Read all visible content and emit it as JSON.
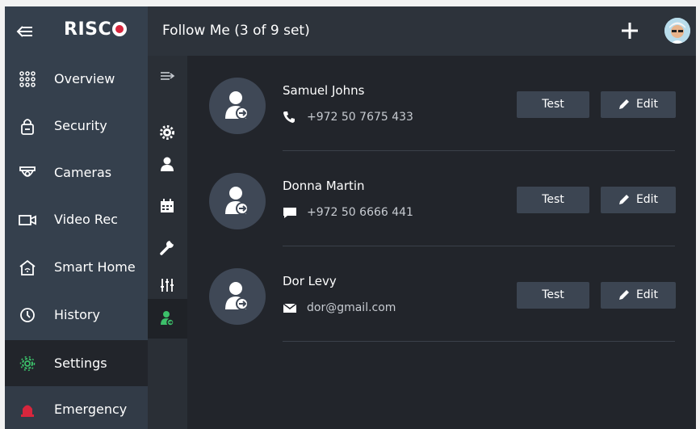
{
  "topbar": {
    "title": "Follow Me (3 of 9 set)"
  },
  "sidebar": {
    "logo": "RISC",
    "items": [
      {
        "label": "Overview",
        "icon": "grid-icon"
      },
      {
        "label": "Security",
        "icon": "lock-icon"
      },
      {
        "label": "Cameras",
        "icon": "camera-icon"
      },
      {
        "label": "Video Rec",
        "icon": "video-icon"
      },
      {
        "label": "Smart Home",
        "icon": "home-icon"
      },
      {
        "label": "History",
        "icon": "history-icon"
      },
      {
        "label": "Settings",
        "icon": "gear-icon",
        "active": true
      },
      {
        "label": "Emergency",
        "icon": "siren-icon"
      }
    ]
  },
  "colors": {
    "accent": "#3cc06a",
    "emergency": "#d7263d",
    "background": "#22252b",
    "sidebar": "#35404d"
  },
  "contacts": [
    {
      "name": "Samuel Johns",
      "contact": "+972 50 7675 433",
      "type": "phone-icon",
      "test_label": "Test",
      "edit_label": "Edit"
    },
    {
      "name": "Donna Martin",
      "contact": "+972 50 6666 441",
      "type": "sms-icon",
      "test_label": "Test",
      "edit_label": "Edit"
    },
    {
      "name": "Dor Levy",
      "contact": "dor@gmail.com",
      "type": "email-icon",
      "test_label": "Test",
      "edit_label": "Edit"
    }
  ]
}
